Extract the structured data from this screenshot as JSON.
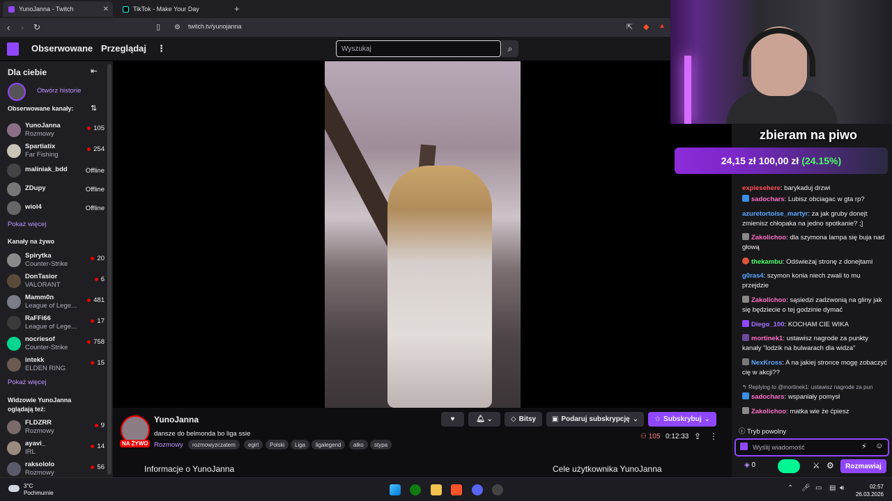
{
  "browser": {
    "tabs": [
      {
        "label": "YunoJanna - Twitch",
        "active": true
      },
      {
        "label": "TikTok - Make Your Day",
        "active": false
      }
    ],
    "url": "twitch.tv/yunojanna"
  },
  "topnav": {
    "followed": "Obserwowane",
    "browse": "Przeglądaj",
    "search_placeholder": "Wyszukaj"
  },
  "sidebar": {
    "for_you": "Dla ciebie",
    "story": "Otwórz historie",
    "followed_header": "Obserwowane kanały:",
    "followed": [
      {
        "name": "YunoJanna",
        "game": "Rozmowy",
        "viewers": "105"
      },
      {
        "name": "Spartiatix",
        "game": "Far Fishing",
        "viewers": "254"
      },
      {
        "name": "maliniak_bdd",
        "status": "Offline"
      },
      {
        "name": "ZDupy",
        "status": "Offline"
      },
      {
        "name": "wiol4",
        "status": "Offline"
      }
    ],
    "show_more": "Pokaż więcej",
    "live_header": "Kanały na żywo",
    "live": [
      {
        "name": "Spirytka",
        "game": "Counter-Strike",
        "viewers": "20"
      },
      {
        "name": "DonTasior",
        "game": "VALORANT",
        "viewers": "6"
      },
      {
        "name": "Mamm0n",
        "game": "League of Lege...",
        "viewers": "481"
      },
      {
        "name": "RaFFi66",
        "game": "League of Lege...",
        "viewers": "17"
      },
      {
        "name": "nocriesof",
        "game": "Counter-Strike",
        "viewers": "758"
      },
      {
        "name": "intekk",
        "game": "ELDEN RING",
        "viewers": "15"
      }
    ],
    "show_more2": "Pokaż więcej",
    "also_watch_header": "Widzowie YunoJanna oglądają też:",
    "also_watch": [
      {
        "name": "FLDZRR",
        "game": "Rozmowy",
        "viewers": "9"
      },
      {
        "name": "ayavi_",
        "game": "IRL",
        "viewers": "14"
      },
      {
        "name": "raksololo",
        "game": "Rozmowy",
        "viewers": "56"
      }
    ]
  },
  "channel": {
    "name": "YunoJanna",
    "live": "NA ŻYWO",
    "title": "dansze do belmonda bo liga ssie",
    "category": "Rozmowy",
    "tags": [
      "rozmowyzczatem",
      "egirl",
      "Polski",
      "Liga",
      "ligalegend",
      "alko",
      "stypa"
    ],
    "bits": "Bitsy",
    "gift": "Podaruj subskrypcję",
    "subscribe": "Subskrybuj",
    "viewers": "105",
    "uptime": "0:12:33",
    "about": "Informacje o YunoJanna",
    "goals": "Cele użytkownika YunoJanna"
  },
  "donation": {
    "title": "zbieram na piwo",
    "current": "24,15 zł",
    "goal": "100,00 zł",
    "percent": "(24.15%)"
  },
  "chat": {
    "messages": [
      {
        "user": "expiesehere",
        "color": "#ff4f4f",
        "text": "barykaduj drzwi"
      },
      {
        "user": "sadochars",
        "color": "#ff6ec7",
        "text": "Lubisz obciagac w gta rp?"
      },
      {
        "user": "azuretortoise_martyr",
        "color": "#5ca8ff",
        "text": "za jak gruby donejt zmienisz chłopaka na jedno spotkanie? ;]"
      },
      {
        "user": "Zakolichoo",
        "color": "#ff6ec7",
        "text": "dla szymona lampa się buja nad głową"
      },
      {
        "user": "thekambu",
        "color": "#4dff6a",
        "text": "Odświeżaj stronę z donejtami"
      },
      {
        "user": "g0ras4",
        "color": "#5ca8ff",
        "text": "szymon konia niech zwali to mu przejdzie"
      },
      {
        "user": "Zakolichoo",
        "color": "#ff6ec7",
        "text": "sąsiedzi zadzwonią na gliny jak się będziecie o tej godzinie dymać"
      },
      {
        "user": "Diego_100",
        "color": "#a970ff",
        "text": "KOCHAM CIE WIKA"
      },
      {
        "user": "mortinek1",
        "color": "#ff6ec7",
        "text": "ustawisz nagrode za punkty kanały \"lodzik na bulwarach dla widza\""
      },
      {
        "user": "NexKross",
        "color": "#5ca8ff",
        "text": "A na jakiej stronce mogę zobaczyć cię w akcji??"
      },
      {
        "user": "sadochars",
        "color": "#ff6ec7",
        "text": "wspaniały pomysł"
      },
      {
        "user": "Zakolichoo",
        "color": "#ff6ec7",
        "text": "matka wie że ćpiesz"
      }
    ],
    "reply_note": "Replying to @mortinek1: ustawisz nagrode za pun",
    "slow_mode": "Tryb powolny",
    "input_placeholder": "Wyślij wiadomość",
    "points": "0",
    "send": "Rozmawiaj"
  },
  "taskbar": {
    "temp": "3°C",
    "weather": "Pochmurnie",
    "time": "02:57",
    "date": "26.03.2026"
  },
  "colors": {
    "accent": "#9147ff",
    "live": "#eb0400",
    "link": "#bf94ff"
  }
}
